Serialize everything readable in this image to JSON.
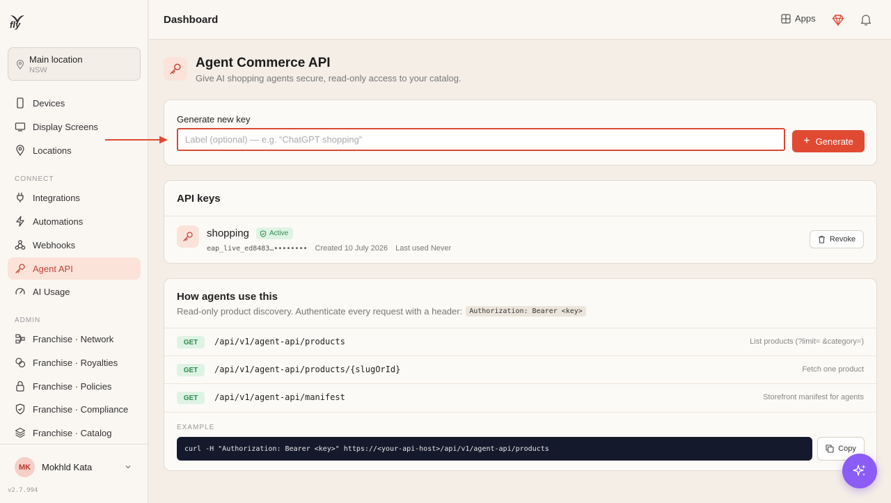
{
  "brand": {
    "logo_text": "fly"
  },
  "location": {
    "title": "Main location",
    "subtitle": "NSW",
    "icon": "map-pin-icon"
  },
  "sidebar": {
    "items": [
      {
        "label": "Devices",
        "icon": "smartphone-icon"
      },
      {
        "label": "Display Screens",
        "icon": "monitor-icon"
      },
      {
        "label": "Locations",
        "icon": "map-pin-icon"
      }
    ],
    "connect_header": "CONNECT",
    "connect_items": [
      {
        "label": "Integrations",
        "icon": "plug-icon"
      },
      {
        "label": "Automations",
        "icon": "zap-icon"
      },
      {
        "label": "Webhooks",
        "icon": "webhook-icon"
      },
      {
        "label": "Agent API",
        "icon": "key-icon",
        "active": true
      },
      {
        "label": "AI Usage",
        "icon": "gauge-icon"
      }
    ],
    "admin_header": "ADMIN",
    "admin_items": [
      {
        "label": "Franchise · Network",
        "icon": "network-icon"
      },
      {
        "label": "Franchise · Royalties",
        "icon": "coins-icon"
      },
      {
        "label": "Franchise · Policies",
        "icon": "lock-icon"
      },
      {
        "label": "Franchise · Compliance",
        "icon": "shield-icon"
      },
      {
        "label": "Franchise · Catalog",
        "icon": "layers-icon"
      }
    ]
  },
  "user": {
    "initials": "MK",
    "name": "Mokhld Kata"
  },
  "version": "v2.7.994",
  "topbar": {
    "title": "Dashboard",
    "apps_label": "Apps"
  },
  "page": {
    "title": "Agent Commerce API",
    "subtitle": "Give AI shopping agents secure, read-only access to your catalog."
  },
  "generate": {
    "label": "Generate new key",
    "placeholder": "Label (optional) — e.g. “ChatGPT shopping”",
    "value": "",
    "button_label": "Generate"
  },
  "api_keys": {
    "title": "API keys",
    "keys": [
      {
        "name": "shopping",
        "status": "Active",
        "masked_key": "eap_live_ed8483…••••••••",
        "created": "Created 10 July 2026",
        "last_used": "Last used Never",
        "revoke_label": "Revoke"
      }
    ]
  },
  "how": {
    "title": "How agents use this",
    "subtitle": "Read-only product discovery. Authenticate every request with a header:",
    "header_code": "Authorization: Bearer <key>",
    "endpoints": [
      {
        "method": "GET",
        "path": "/api/v1/agent-api/products",
        "desc": "List products (?limit= &category=)"
      },
      {
        "method": "GET",
        "path": "/api/v1/agent-api/products/{slugOrId}",
        "desc": "Fetch one product"
      },
      {
        "method": "GET",
        "path": "/api/v1/agent-api/manifest",
        "desc": "Storefront manifest for agents"
      }
    ],
    "example_label": "EXAMPLE",
    "example_code": "curl -H \"Authorization: Bearer <key>\" https://<your-api-host>/api/v1/agent-api/products",
    "copy_label": "Copy"
  },
  "colors": {
    "accent": "#e04a33",
    "active_bg": "#fbe3da",
    "success": "#2f8a4c",
    "fab": "#8b5cf6"
  }
}
